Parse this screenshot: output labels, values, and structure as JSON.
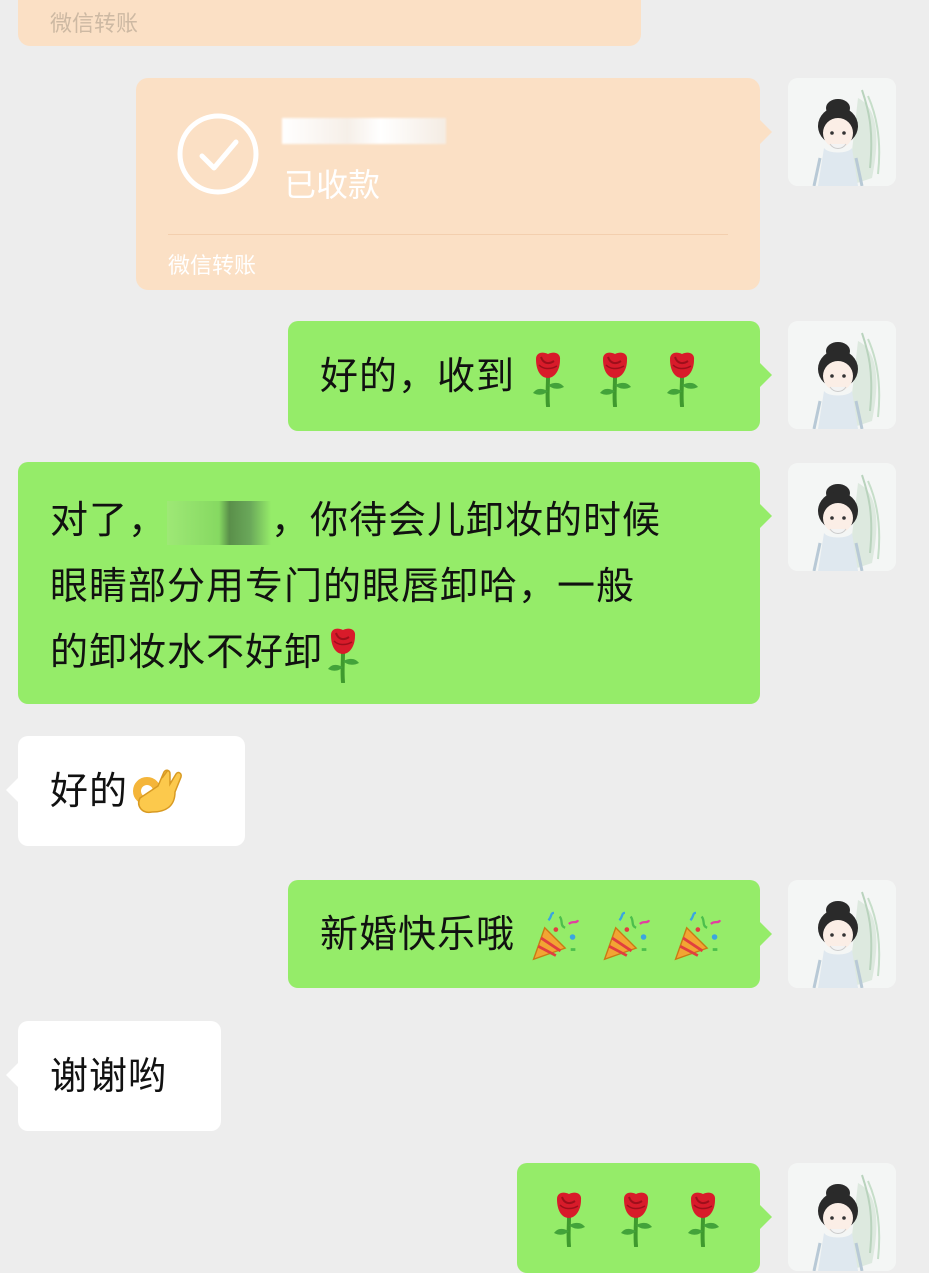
{
  "transfer_top": {
    "footer": "微信转账"
  },
  "transfer": {
    "status": "已收款",
    "footer": "微信转账"
  },
  "messages": {
    "m1": {
      "text": "好的，收到"
    },
    "m2": {
      "line1a": "对了，",
      "line1b": "，你待会儿卸妆的时候",
      "line2": "眼睛部分用专门的眼唇卸哈，一般",
      "line3": "的卸妆水不好卸"
    },
    "m3": {
      "text": "好的"
    },
    "m4": {
      "text": "新婚快乐哦"
    },
    "m5": {
      "text": "谢谢哟"
    }
  },
  "icons": {
    "rose": "rose-emoji",
    "ok": "ok-hand-emoji",
    "party": "party-popper-emoji",
    "check": "check-circle-icon"
  },
  "colors": {
    "background": "#ededed",
    "green_bubble": "#95ec69",
    "transfer_bubble": "#fbe0c5",
    "white_bubble": "#ffffff"
  }
}
